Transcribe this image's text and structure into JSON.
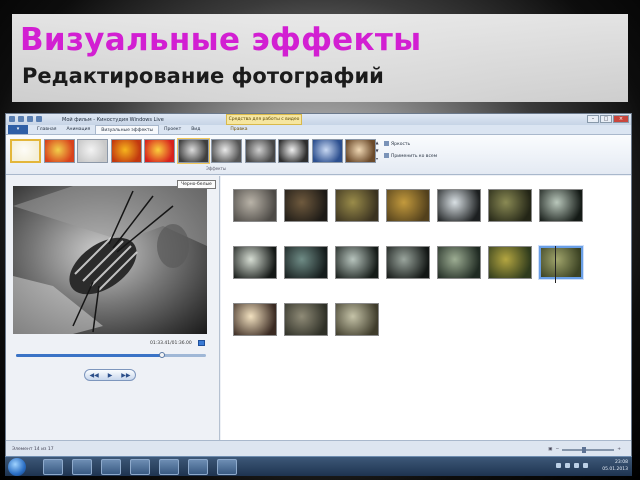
{
  "slide": {
    "title": "Визуальные эффекты",
    "subtitle": "Редактирование фотографий",
    "title_color": "#d21fd2"
  },
  "window": {
    "app_title": "Мой фильм - Киностудия Windows Live",
    "context_tab_group": "Средства для работы с видео",
    "controls": [
      "–",
      "□",
      "×"
    ]
  },
  "ribbon": {
    "file_button": "",
    "tabs": [
      {
        "label": "Главная",
        "active": false
      },
      {
        "label": "Анимация",
        "active": false
      },
      {
        "label": "Визуальные эффекты",
        "active": true
      },
      {
        "label": "Проект",
        "active": false
      },
      {
        "label": "Вид",
        "active": false
      },
      {
        "label": "Правка",
        "active": false,
        "contextual": true
      }
    ],
    "group_label": "Эффекты",
    "effects": [
      {
        "name": "none",
        "colors": [
          "#fdfcf7",
          "#f4efd9"
        ],
        "selected": true
      },
      {
        "name": "fire",
        "colors": [
          "#f2d04a",
          "#d8421c"
        ]
      },
      {
        "name": "fade",
        "colors": [
          "#f3f3f3",
          "#c9c9c9"
        ]
      },
      {
        "name": "orange",
        "colors": [
          "#f6b51d",
          "#c2380f"
        ]
      },
      {
        "name": "red",
        "colors": [
          "#fbd03c",
          "#d7221d"
        ]
      },
      {
        "name": "bw",
        "colors": [
          "#dcdcdc",
          "#3e3e3e"
        ],
        "hovered": true
      },
      {
        "name": "bw-light",
        "colors": [
          "#e9e9e9",
          "#555"
        ]
      },
      {
        "name": "bw-dark",
        "colors": [
          "#cfcfcf",
          "#474747"
        ]
      },
      {
        "name": "bw-contrast",
        "colors": [
          "#f0f0f0",
          "#2e2e2e"
        ]
      },
      {
        "name": "blue",
        "colors": [
          "#c8d8f2",
          "#2c4f8f"
        ]
      },
      {
        "name": "sepia",
        "colors": [
          "#efd7b3",
          "#6b4a2b"
        ]
      }
    ],
    "brightness_label": "Яркость",
    "apply_all_label": "Применить ко всем",
    "tooltip": "Черно-белые"
  },
  "preview": {
    "time": "01:33.41/01:36.00",
    "progress": 0.77,
    "controls": [
      "◀◀",
      "▶",
      "▶▶"
    ]
  },
  "storyboard": {
    "rows": [
      [
        {
          "c1": "#b9b3a8",
          "c2": "#4d4a46"
        },
        {
          "c1": "#6f5a3e",
          "c2": "#1d1a16"
        },
        {
          "c1": "#9a8c4a",
          "c2": "#3a3220"
        },
        {
          "c1": "#c39a3d",
          "c2": "#52401c"
        },
        {
          "c1": "#d9e0e4",
          "c2": "#1c1f20"
        },
        {
          "c1": "#8a8a54",
          "c2": "#232516"
        },
        {
          "c1": "#b9c7bb",
          "c2": "#141a16"
        }
      ],
      [
        {
          "c1": "#d6ddd3",
          "c2": "#141816"
        },
        {
          "c1": "#6f8c86",
          "c2": "#151c1c"
        },
        {
          "c1": "#b7c4bd",
          "c2": "#151b18"
        },
        {
          "c1": "#9aa59d",
          "c2": "#121614"
        },
        {
          "c1": "#9dad93",
          "c2": "#1f2a22"
        },
        {
          "c1": "#b4a641",
          "c2": "#2e3a1c"
        },
        {
          "c1": "#a1a56c",
          "c2": "#3b4223"
        }
      ],
      [
        {
          "c1": "#f2e1c0",
          "c2": "#3a2a22"
        },
        {
          "c1": "#8f8b77",
          "c2": "#2f3027"
        },
        {
          "c1": "#c5c3a8",
          "c2": "#3f3c2b"
        }
      ]
    ],
    "selected": [
      1,
      6
    ]
  },
  "status": {
    "text": "Элемент 14 из 17"
  },
  "taskbar": {
    "clock_time": "23:08",
    "clock_date": "05.01.2013",
    "items": [
      "ie",
      "media-player",
      "explorer",
      "firefox",
      "video-app",
      "paint",
      "powerpoint"
    ]
  }
}
